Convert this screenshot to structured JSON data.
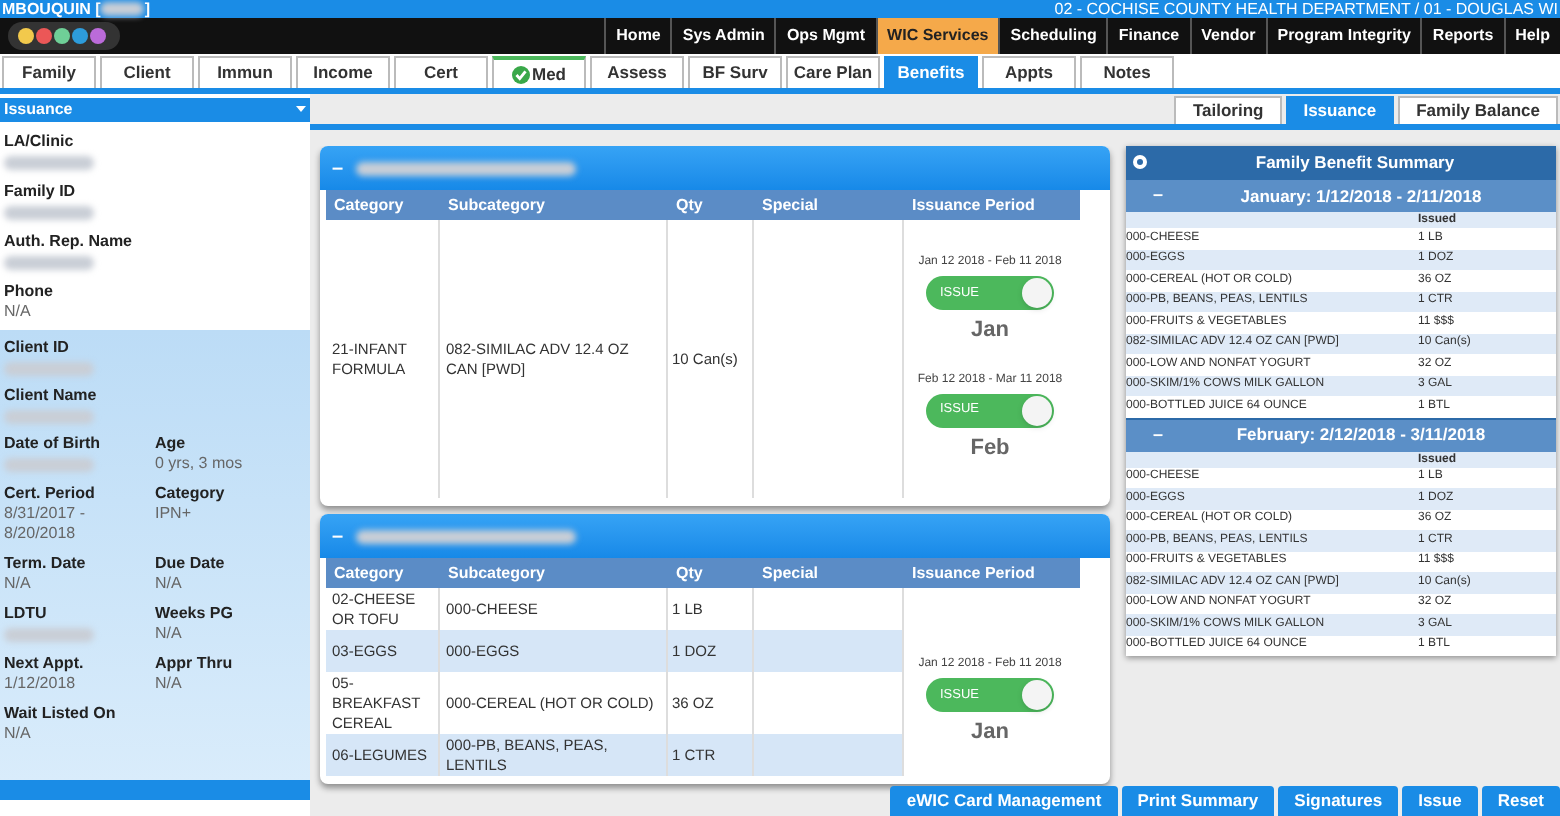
{
  "header": {
    "user_prefix": "MBOUQUIN [",
    "user_suffix": "]",
    "location": "02 - COCHISE COUNTY HEALTH DEPARTMENT / 01 - DOUGLAS WI"
  },
  "menu": [
    {
      "label": "Home",
      "selected": false
    },
    {
      "label": "Sys Admin",
      "selected": false
    },
    {
      "label": "Ops Mgmt",
      "selected": false
    },
    {
      "label": "WIC Services",
      "selected": true
    },
    {
      "label": "Scheduling",
      "selected": false
    },
    {
      "label": "Finance",
      "selected": false
    },
    {
      "label": "Vendor",
      "selected": false
    },
    {
      "label": "Program Integrity",
      "selected": false
    },
    {
      "label": "Reports",
      "selected": false
    },
    {
      "label": "Help",
      "selected": false
    }
  ],
  "tabs": [
    {
      "label": "Family",
      "selected": false,
      "checked": false
    },
    {
      "label": "Client",
      "selected": false,
      "checked": false
    },
    {
      "label": "Immun",
      "selected": false,
      "checked": false
    },
    {
      "label": "Income",
      "selected": false,
      "checked": false
    },
    {
      "label": "Cert",
      "selected": false,
      "checked": false
    },
    {
      "label": "Med",
      "selected": false,
      "checked": true
    },
    {
      "label": "Assess",
      "selected": false,
      "checked": false
    },
    {
      "label": "BF Surv",
      "selected": false,
      "checked": false
    },
    {
      "label": "Care Plan",
      "selected": false,
      "checked": false
    },
    {
      "label": "Benefits",
      "selected": true,
      "checked": false
    },
    {
      "label": "Appts",
      "selected": false,
      "checked": false
    },
    {
      "label": "Notes",
      "selected": false,
      "checked": false
    }
  ],
  "sidebar": {
    "title": "Issuance",
    "family_fields": [
      {
        "label": "LA/Clinic"
      },
      {
        "label": "Family ID"
      },
      {
        "label": "Auth. Rep. Name"
      },
      {
        "label": "Phone",
        "value": "N/A"
      }
    ],
    "client_rows": [
      [
        {
          "label": "Client ID"
        }
      ],
      [
        {
          "label": "Client Name"
        }
      ],
      [
        {
          "label": "Date of Birth"
        },
        {
          "label": "Age",
          "value": "0 yrs, 3 mos"
        }
      ],
      [
        {
          "label": "Cert. Period",
          "value": "8/31/2017 - 8/20/2018"
        },
        {
          "label": "Category",
          "value": "IPN+"
        }
      ],
      [
        {
          "label": "Term. Date",
          "value": "N/A"
        },
        {
          "label": "Due Date",
          "value": "N/A"
        }
      ],
      [
        {
          "label": "LDTU"
        },
        {
          "label": "Weeks PG",
          "value": "N/A"
        }
      ],
      [
        {
          "label": "Next Appt.",
          "value": "1/12/2018"
        },
        {
          "label": "Appr Thru",
          "value": "N/A"
        }
      ],
      [
        {
          "label": "Wait Listed On",
          "value": "N/A"
        }
      ]
    ]
  },
  "subtabs": [
    {
      "label": "Tailoring",
      "selected": false
    },
    {
      "label": "Issuance",
      "selected": true
    },
    {
      "label": "Family Balance",
      "selected": false
    }
  ],
  "panels": [
    {
      "collapse": "–",
      "columns": [
        "Category",
        "Subcategory",
        "Qty",
        "Special",
        "Issuance Period"
      ],
      "rows": [
        {
          "category": "21-INFANT FORMULA",
          "subcategory": "082-SIMILAC ADV 12.4 OZ CAN [PWD]",
          "qty": "10 Can(s)"
        }
      ],
      "periods": [
        {
          "range": "Jan 12 2018 - Feb 11 2018",
          "toggle": "ISSUE",
          "on": true,
          "month": "Jan"
        },
        {
          "range": "Feb 12 2018 - Mar 11 2018",
          "toggle": "ISSUE",
          "on": true,
          "month": "Feb"
        }
      ]
    },
    {
      "collapse": "–",
      "columns": [
        "Category",
        "Subcategory",
        "Qty",
        "Special",
        "Issuance Period"
      ],
      "rows": [
        {
          "category": "02-CHEESE OR TOFU",
          "subcategory": "000-CHEESE",
          "qty": "1 LB"
        },
        {
          "category": "03-EGGS",
          "subcategory": "000-EGGS",
          "qty": "1 DOZ"
        },
        {
          "category": "05-BREAKFAST CEREAL",
          "subcategory": "000-CEREAL (HOT OR COLD)",
          "qty": "36 OZ"
        },
        {
          "category": "06-LEGUMES",
          "subcategory": "000-PB, BEANS, PEAS, LENTILS",
          "qty": "1 CTR"
        }
      ],
      "periods": [
        {
          "range": "Jan 12 2018 - Feb 11 2018",
          "toggle": "ISSUE",
          "on": true,
          "month": "Jan"
        }
      ]
    }
  ],
  "summary": {
    "title": "Family Benefit Summary",
    "months": [
      {
        "collapse": "–",
        "title": "January: 1/12/2018 - 2/11/2018",
        "column": "Issued",
        "items": [
          {
            "name": "000-CHEESE",
            "qty": "1 LB"
          },
          {
            "name": "000-EGGS",
            "qty": "1 DOZ"
          },
          {
            "name": "000-CEREAL (HOT OR COLD)",
            "qty": "36 OZ"
          },
          {
            "name": "000-PB, BEANS, PEAS, LENTILS",
            "qty": "1 CTR"
          },
          {
            "name": "000-FRUITS & VEGETABLES",
            "qty": "11 $$$"
          },
          {
            "name": "082-SIMILAC ADV 12.4 OZ CAN [PWD]",
            "qty": "10 Can(s)"
          },
          {
            "name": "000-LOW AND NONFAT YOGURT",
            "qty": "32 OZ"
          },
          {
            "name": "000-SKIM/1% COWS MILK GALLON",
            "qty": "3 GAL"
          },
          {
            "name": "000-BOTTLED JUICE 64 OUNCE",
            "qty": "1 BTL"
          }
        ]
      },
      {
        "collapse": "–",
        "title": "February: 2/12/2018 - 3/11/2018",
        "column": "Issued",
        "items": [
          {
            "name": "000-CHEESE",
            "qty": "1 LB"
          },
          {
            "name": "000-EGGS",
            "qty": "1 DOZ"
          },
          {
            "name": "000-CEREAL (HOT OR COLD)",
            "qty": "36 OZ"
          },
          {
            "name": "000-PB, BEANS, PEAS, LENTILS",
            "qty": "1 CTR"
          },
          {
            "name": "000-FRUITS & VEGETABLES",
            "qty": "11 $$$"
          },
          {
            "name": "082-SIMILAC ADV 12.4 OZ CAN [PWD]",
            "qty": "10 Can(s)"
          },
          {
            "name": "000-LOW AND NONFAT YOGURT",
            "qty": "32 OZ"
          },
          {
            "name": "000-SKIM/1% COWS MILK GALLON",
            "qty": "3 GAL"
          },
          {
            "name": "000-BOTTLED JUICE 64 OUNCE",
            "qty": "1 BTL"
          }
        ]
      }
    ]
  },
  "buttons": [
    "eWIC Card Management",
    "Print Summary",
    "Signatures",
    "Issue",
    "Reset"
  ]
}
